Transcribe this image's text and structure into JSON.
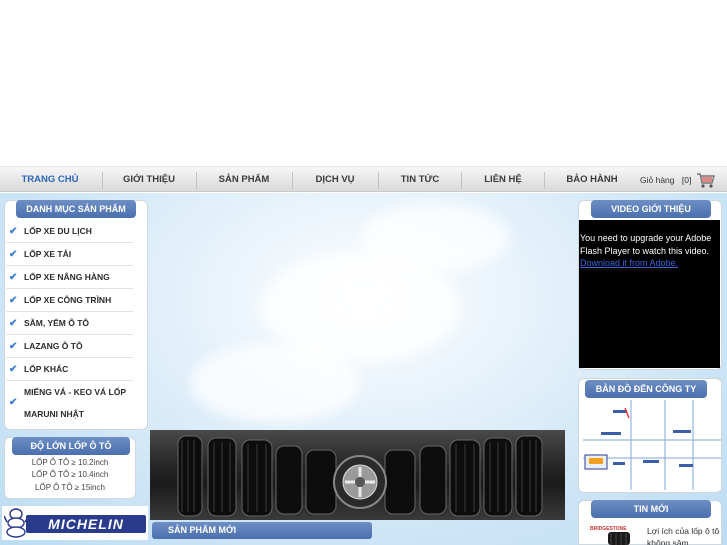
{
  "nav": {
    "items": [
      {
        "label": "TRANG CHỦ",
        "active": true
      },
      {
        "label": "GIỚI THIỆU",
        "active": false
      },
      {
        "label": "SẢN PHẨM",
        "active": false
      },
      {
        "label": "DỊCH VỤ",
        "active": false
      },
      {
        "label": "TIN TỨC",
        "active": false
      },
      {
        "label": "LIÊN HỆ",
        "active": false
      },
      {
        "label": "BẢO HÀNH",
        "active": false
      }
    ],
    "cart_label": "Giỏ hàng",
    "cart_count": "[0]"
  },
  "categories": {
    "title": "DANH MỤC SẢN PHẨM",
    "items": [
      {
        "label": "LỐP XE DU LỊCH"
      },
      {
        "label": "LỐP XE TẢI"
      },
      {
        "label": "LỐP XE NÂNG HÀNG"
      },
      {
        "label": "LỐP XE CÔNG TRÌNH"
      },
      {
        "label": "SĂM, YẾM Ô TÔ"
      },
      {
        "label": "LAZANG Ô TÔ"
      },
      {
        "label": "LỐP KHÁC"
      },
      {
        "label_line1": "MIẾNG VÁ - KEO VÁ LỐP",
        "label_line2": "MARUNI NHẬT"
      }
    ]
  },
  "tire_size": {
    "title": "ĐỘ LỚN LỐP Ô TÔ",
    "links": [
      "LỐP Ô TÔ ≥ 10.2inch",
      "LỐP Ô TÔ ≥ 10.4inch",
      "LỐP Ô TÔ ≥ 15inch"
    ]
  },
  "brand": {
    "logo_text": "MICHELIN"
  },
  "new_products": {
    "title": "SẢN PHẨM MỚI"
  },
  "video": {
    "title": "VIDEO GIỚI THIỆU",
    "flash_message": "You need to upgrade your Adobe Flash Player to watch this video.",
    "flash_link": "Download it from Adobe."
  },
  "map": {
    "title": "BẢN ĐỒ ĐẾN CÔNG TY"
  },
  "news": {
    "title": "TIN MỚI",
    "item_text": "Lợi ích của lốp ô tô không săm"
  },
  "colors": {
    "accent": "#4a6fae",
    "nav_active": "#2c66b8",
    "check": "#3a7fd0",
    "michelin_blue": "#2a3a8c"
  }
}
